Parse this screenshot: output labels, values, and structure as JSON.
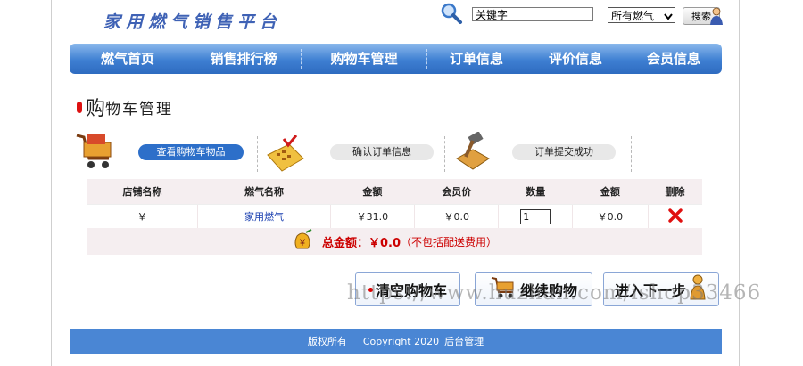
{
  "header": {
    "brand": "家用燃气销售平台",
    "search": {
      "placeholder": "关键字",
      "value": "关键字",
      "category": "所有燃气",
      "button_label": "搜索"
    }
  },
  "nav": {
    "items": [
      {
        "label": "燃气首页"
      },
      {
        "label": "销售排行榜"
      },
      {
        "label": "购物车管理"
      },
      {
        "label": "订单信息"
      },
      {
        "label": "评价信息"
      },
      {
        "label": "会员信息"
      }
    ]
  },
  "section": {
    "title_first": "购",
    "title_rest": "物车管理"
  },
  "steps": [
    {
      "label": "查看购物车物品",
      "active": true
    },
    {
      "label": "确认订单信息",
      "active": false
    },
    {
      "label": "订单提交成功",
      "active": false
    }
  ],
  "cart": {
    "columns": [
      "店铺名称",
      "燃气名称",
      "金额",
      "会员价",
      "数量",
      "金额",
      "删除"
    ],
    "rows": [
      {
        "shop": "￥",
        "gas_name": "家用燃气",
        "price": "￥31.0",
        "member_price": "￥0.0",
        "quantity": "1",
        "amount": "￥0.0"
      }
    ],
    "total_label": "总金额：￥0.0",
    "total_note": "（不包括配送费用）"
  },
  "actions": {
    "clear_label": "清空购物车",
    "continue_label": "继续购物",
    "next_label": "进入下一步"
  },
  "watermark": "https://www.huzhan.com/ishop33466",
  "footer": {
    "rights": "版权所有",
    "copyright": "Copyright 2020",
    "admin_link": "后台管理"
  },
  "colors": {
    "nav": "#3e7fd2",
    "footer": "#4a86d4",
    "accent_red": "#cc0000",
    "step_active": "#2d6fc9"
  }
}
